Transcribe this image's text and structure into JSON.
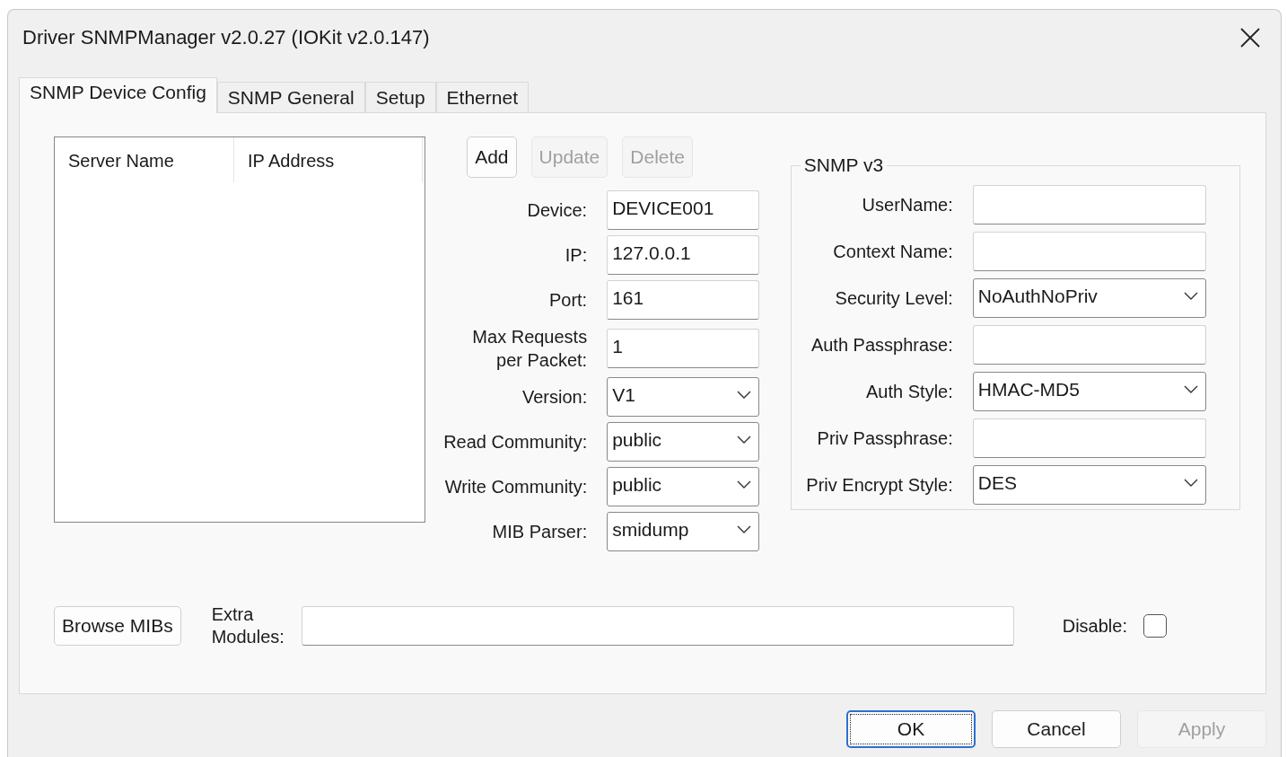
{
  "window": {
    "title": "Driver SNMPManager v2.0.27 (IOKit v2.0.147)"
  },
  "tabs": [
    {
      "label": "SNMP Device Config",
      "selected": true
    },
    {
      "label": "SNMP General",
      "selected": false
    },
    {
      "label": "Setup",
      "selected": false
    },
    {
      "label": "Ethernet",
      "selected": false
    }
  ],
  "server_list": {
    "columns": [
      "Server Name",
      "IP Address"
    ]
  },
  "list_buttons": [
    {
      "label": "Add",
      "disabled": false
    },
    {
      "label": "Update",
      "disabled": true
    },
    {
      "label": "Delete",
      "disabled": true
    }
  ],
  "device_fields": [
    {
      "label": "Device:",
      "kind": "text",
      "value": "DEVICE001"
    },
    {
      "label": "IP:",
      "kind": "text",
      "value": "127.0.0.1"
    },
    {
      "label": "Port:",
      "kind": "text",
      "value": "161"
    },
    {
      "label": "Max Requests per Packet:",
      "kind": "text",
      "value": "1"
    },
    {
      "label": "Version:",
      "kind": "select",
      "value": "V1"
    },
    {
      "label": "Read Community:",
      "kind": "select",
      "value": "public"
    },
    {
      "label": "Write Community:",
      "kind": "select",
      "value": "public"
    },
    {
      "label": "MIB Parser:",
      "kind": "select",
      "value": "smidump"
    }
  ],
  "snmp_v3": {
    "title": "SNMP v3",
    "fields": [
      {
        "label": "UserName:",
        "kind": "text"
      },
      {
        "label": "Context Name:",
        "kind": "text"
      },
      {
        "label": "Security Level:",
        "kind": "select",
        "value": "NoAuthNoPriv"
      },
      {
        "label": "Auth Passphrase:",
        "kind": "text"
      },
      {
        "label": "Auth Style:",
        "kind": "select",
        "value": "HMAC-MD5"
      },
      {
        "label": "Priv Passphrase:",
        "kind": "text"
      },
      {
        "label": "Priv Encrypt Style:",
        "kind": "select",
        "value": "DES"
      }
    ]
  },
  "browse_button": {
    "label": "Browse MIBs"
  },
  "extra_modules": {
    "label": "Extra Modules:"
  },
  "disable": {
    "label": "Disable:",
    "checked": false
  },
  "dialog_buttons": [
    {
      "label": "OK",
      "disabled": false,
      "focused": true
    },
    {
      "label": "Cancel",
      "disabled": false,
      "focused": false
    },
    {
      "label": "Apply",
      "disabled": true,
      "focused": false
    }
  ]
}
